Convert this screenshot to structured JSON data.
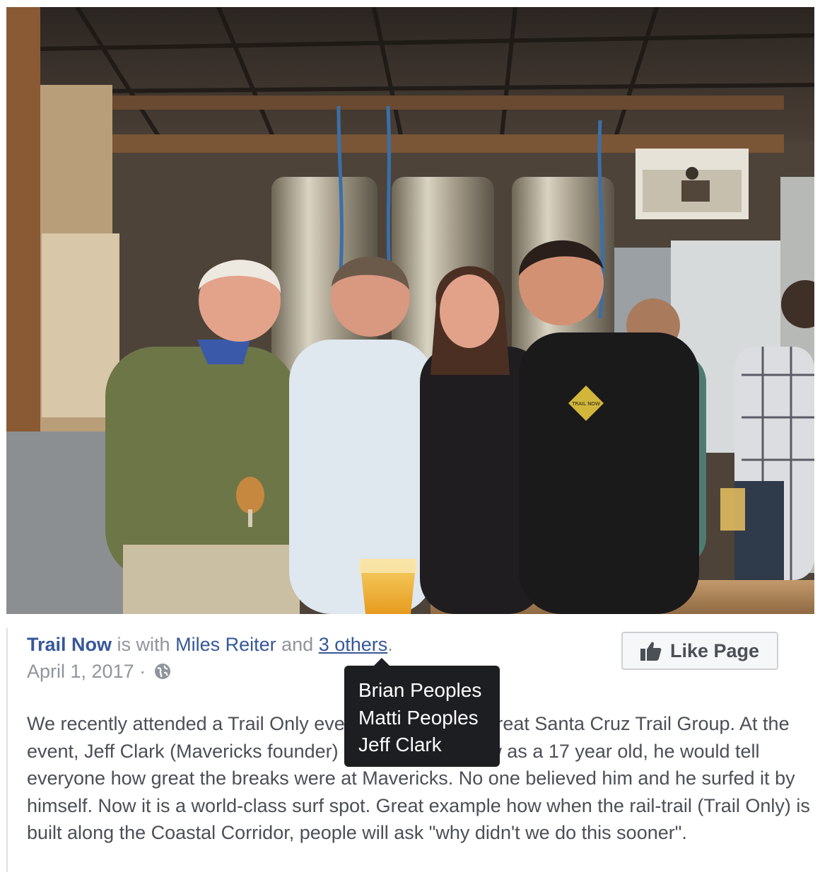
{
  "post": {
    "page_name": "Trail Now",
    "is_with_text": "is with",
    "tagged_person": "Miles Reiter",
    "and_text": "and",
    "others_link": "3 others",
    "period": ".",
    "date": "April 1, 2017",
    "separator": "·",
    "like_button_label": "Like Page",
    "body": "We recently attended a Trail Only event hosted by the great Santa Cruz Trail Group. At the event, Jeff Clark (Mavericks founder) said that back now as a 17 year old, he would tell everyone how great the breaks were at Mavericks. No one believed him and he surfed it by himself. Now it is a world-class surf spot. Great example how when the rail-trail (Trail Only) is built along the Coastal Corridor, people will ask \"why didn't we do this sooner\"."
  },
  "tooltip": {
    "names": [
      "Brian Peoples",
      "Matti Peoples",
      "Jeff Clark"
    ]
  },
  "photo": {
    "sign_text": "TRAIL NOW"
  },
  "colors": {
    "link": "#365899",
    "muted": "#90949c",
    "body_text": "#4b4f56",
    "tooltip_bg": "#1c1e21"
  },
  "icons": {
    "audience": "globe-icon",
    "like": "thumbs-up-icon"
  }
}
